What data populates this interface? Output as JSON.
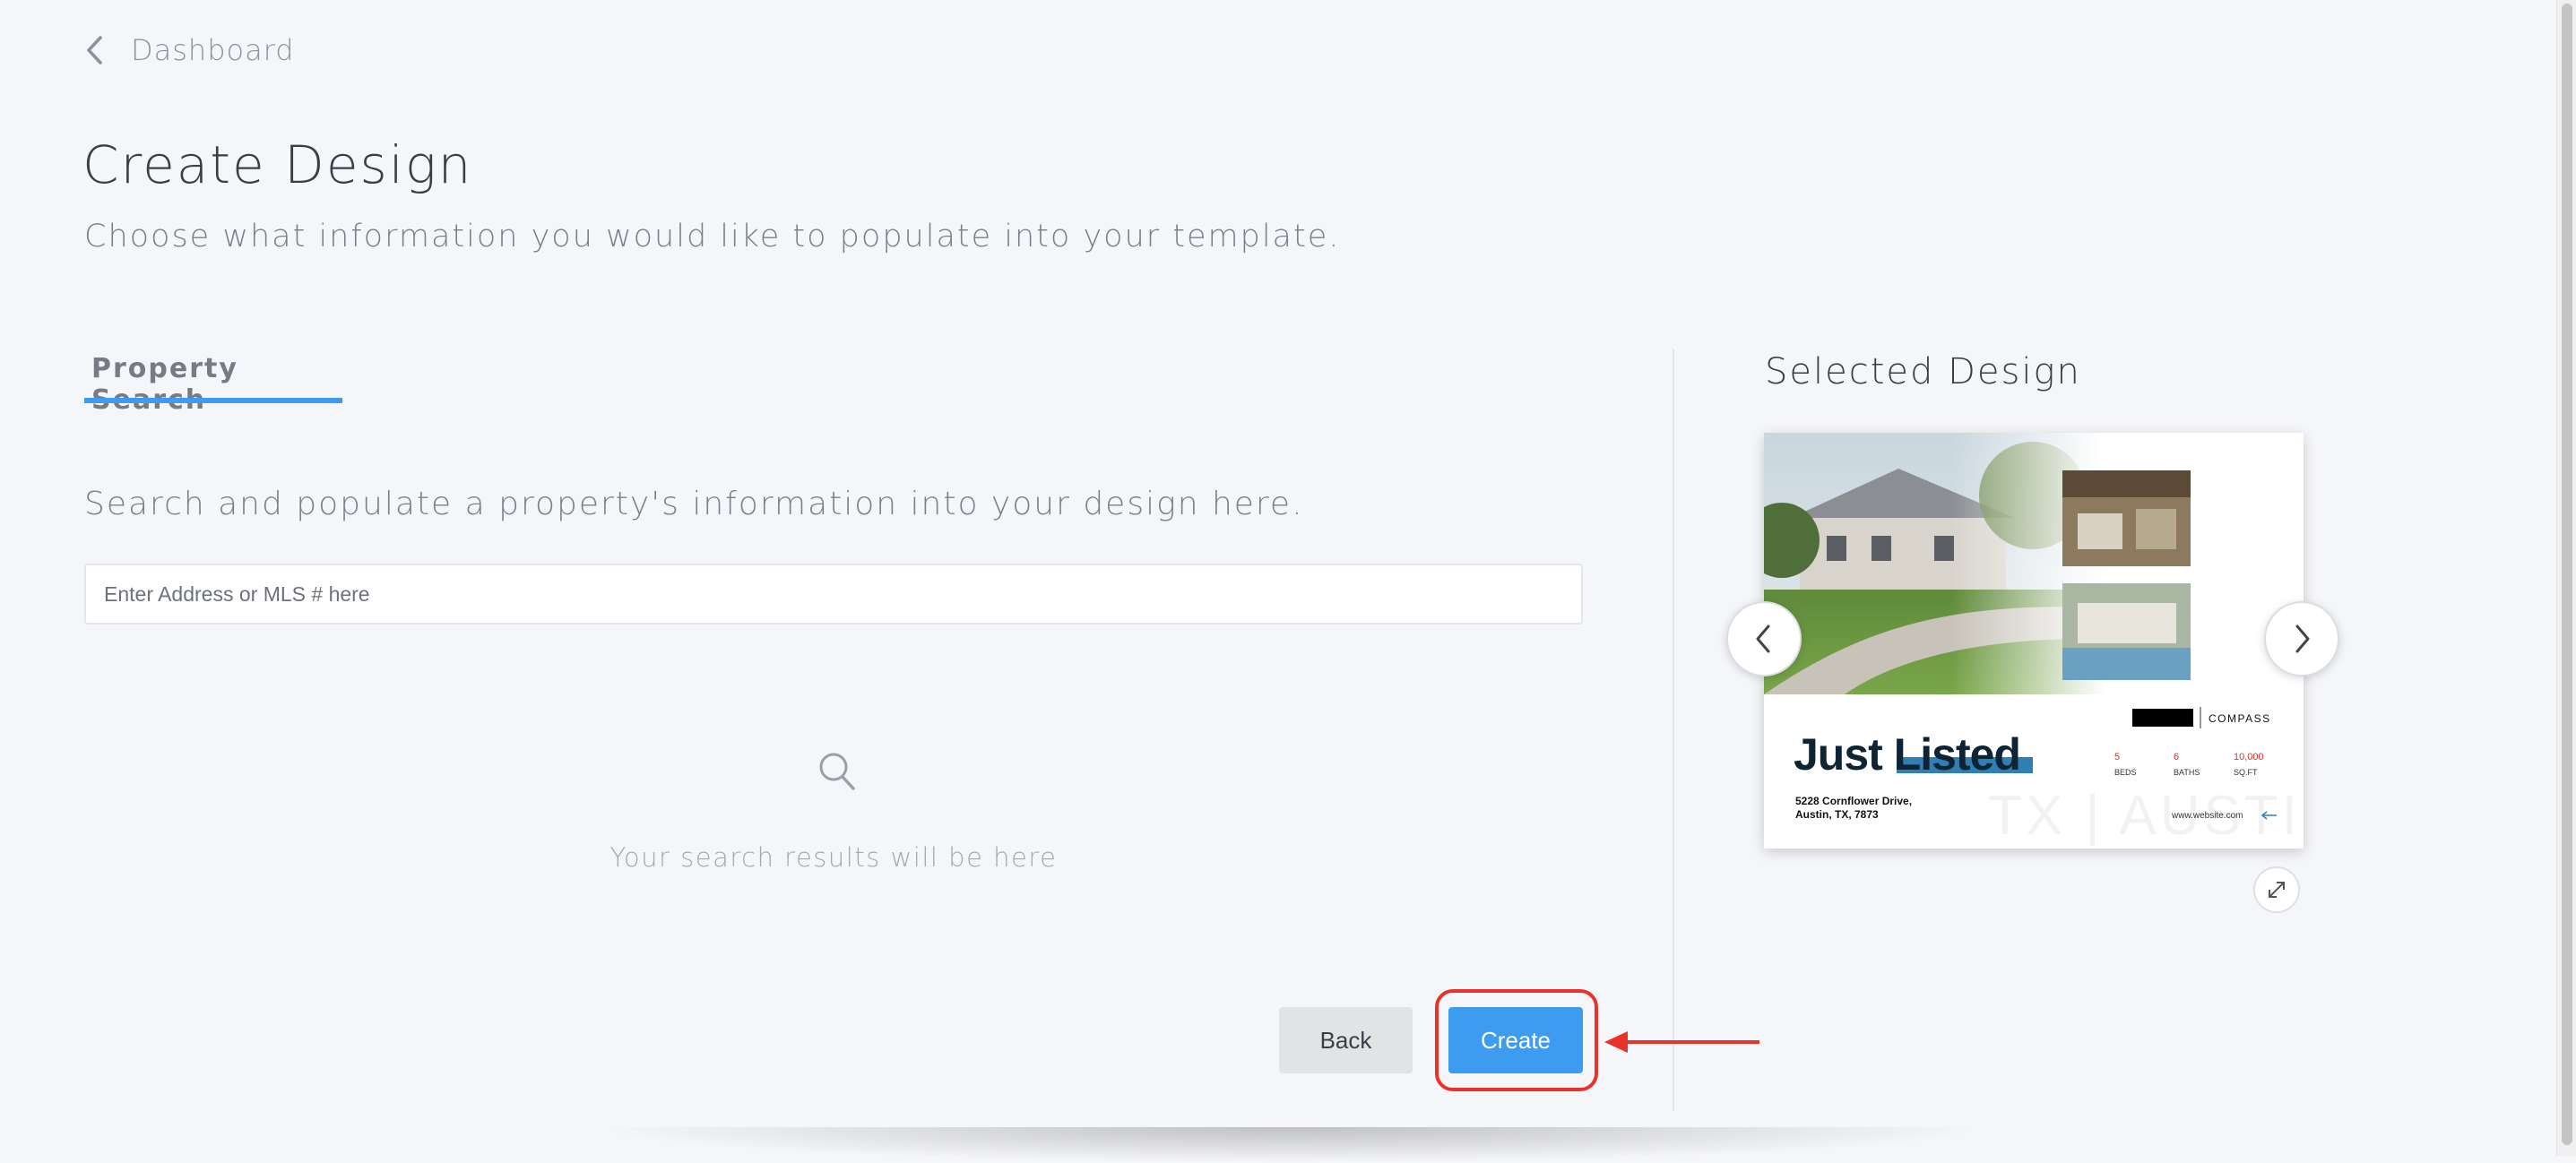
{
  "nav": {
    "back_label": "Dashboard"
  },
  "header": {
    "title": "Create Design",
    "subtitle": "Choose what information you would like to populate into your template."
  },
  "tabs": [
    {
      "label": "Property Search",
      "active": true
    }
  ],
  "search": {
    "description": "Search and populate a property's information into your design here.",
    "placeholder": "Enter Address or MLS # here",
    "value": "",
    "empty_state": "Your search results will be here"
  },
  "selected_design": {
    "title": "Selected Design",
    "preview": {
      "headline": "Just Listed",
      "brand": "COMPASS",
      "stats": [
        {
          "value": "5",
          "label": "BEDS"
        },
        {
          "value": "6",
          "label": "BATHS"
        },
        {
          "value": "10,000",
          "label": "SQ.FT"
        }
      ],
      "address_line1": "5228 Cornflower Drive,",
      "address_line2": "Austin, TX, 7873",
      "website": "www.website.com",
      "watermark": "TX | AUSTIN"
    }
  },
  "actions": {
    "back_label": "Back",
    "create_label": "Create"
  },
  "colors": {
    "accent": "#3d9cf0",
    "highlight": "#e8332a",
    "stat_red": "#e0322b"
  },
  "icons": {
    "back": "chevron-left-icon",
    "search": "search-icon",
    "prev": "chevron-left-icon",
    "next": "chevron-right-icon",
    "expand": "expand-icon"
  }
}
